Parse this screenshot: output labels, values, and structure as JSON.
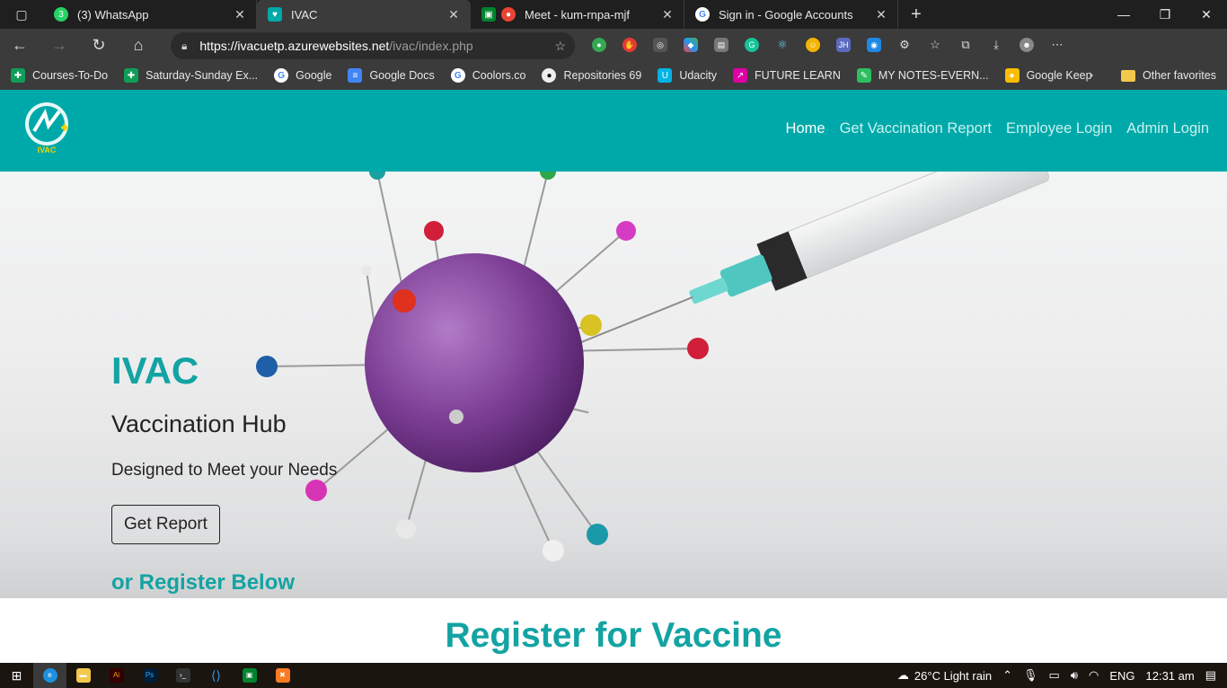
{
  "browser": {
    "tabs": [
      {
        "title": "(3) WhatsApp",
        "badge": "3",
        "color": "#25d366",
        "active": false
      },
      {
        "title": "IVAC",
        "color": "#00a9a9",
        "active": true
      },
      {
        "title": "Meet - kum-rnpa-mjf",
        "color": "#ea4335",
        "active": false
      },
      {
        "title": "Sign in - Google Accounts",
        "color": "#4285f4",
        "active": false
      }
    ],
    "address": {
      "host": "https://ivacuetp.azurewebsites.net",
      "path": "/ivac/index.php"
    },
    "bookmarks": [
      {
        "label": "Courses-To-Do",
        "color": "#0f9d58"
      },
      {
        "label": "Saturday-Sunday Ex...",
        "color": "#0f9d58"
      },
      {
        "label": "Google",
        "color": "#4285f4"
      },
      {
        "label": "Google Docs",
        "color": "#4285f4"
      },
      {
        "label": "Coolors.co",
        "color": "#2f6bff"
      },
      {
        "label": "Repositories 69",
        "color": "#333333"
      },
      {
        "label": "Udacity",
        "color": "#02b3e4"
      },
      {
        "label": "FUTURE LEARN",
        "color": "#de00a5"
      },
      {
        "label": "MY NOTES-EVERN...",
        "color": "#2dbe60"
      },
      {
        "label": "Google Keep",
        "color": "#fbbc04"
      }
    ],
    "other_favorites": "Other favorites"
  },
  "site": {
    "brand": "IVAC",
    "nav": {
      "home": "Home",
      "report": "Get Vaccination Report",
      "employee": "Employee Login",
      "admin": "Admin Login"
    },
    "hero": {
      "title": "IVAC",
      "subtitle": "Vaccination Hub",
      "tagline": "Designed to Meet your Needs",
      "button": "Get Report",
      "register": "or Register Below"
    },
    "section_title": "Register for Vaccine"
  },
  "taskbar": {
    "weather": "26°C  Light rain",
    "language": "ENG",
    "time": "12:31 am"
  },
  "colors": {
    "brand": "#00a9a9",
    "heading": "#14a3a3"
  }
}
